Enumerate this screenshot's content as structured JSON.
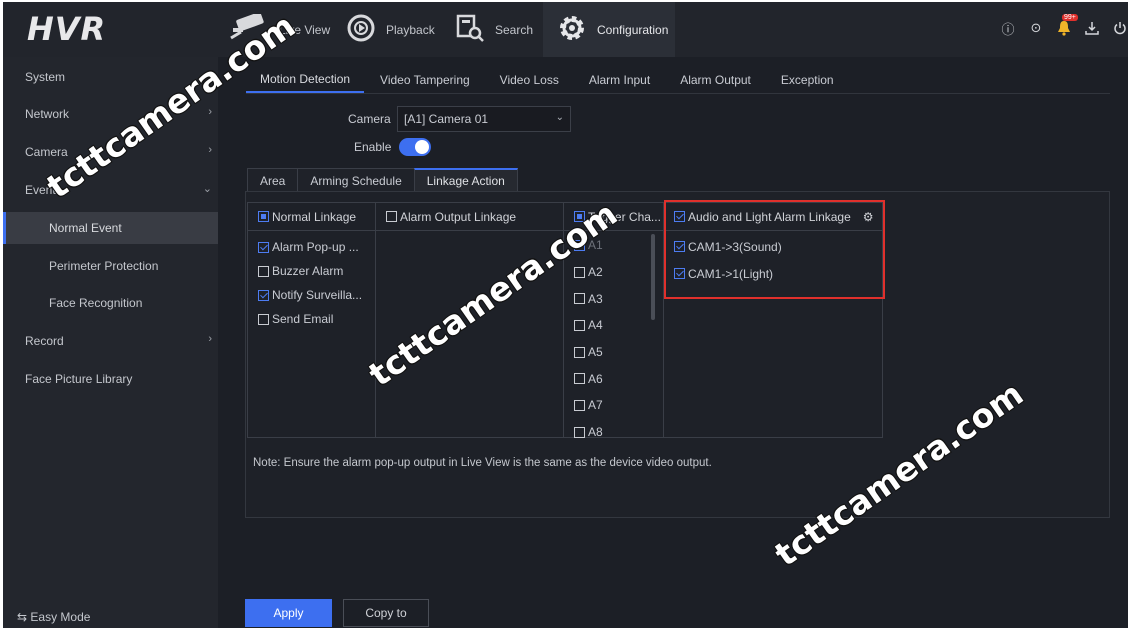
{
  "header": {
    "logo": "HVR",
    "nav": [
      {
        "label": "Live View",
        "icon": "camera-icon"
      },
      {
        "label": "Playback",
        "icon": "playback-icon"
      },
      {
        "label": "Search",
        "icon": "search-icon"
      },
      {
        "label": "Configuration",
        "icon": "gear-icon",
        "active": true
      }
    ],
    "badge": "99+"
  },
  "sidebar": {
    "items": [
      {
        "label": "System"
      },
      {
        "label": "Network"
      },
      {
        "label": "Camera"
      },
      {
        "label": "Event"
      },
      {
        "label": "Normal Event"
      },
      {
        "label": "Perimeter Protection"
      },
      {
        "label": "Face Recognition"
      },
      {
        "label": "Record"
      },
      {
        "label": "Face Picture Library"
      }
    ],
    "easy_mode": "⇆ Easy Mode"
  },
  "main_tabs": [
    "Motion Detection",
    "Video Tampering",
    "Video Loss",
    "Alarm Input",
    "Alarm Output",
    "Exception"
  ],
  "camera": {
    "label": "Camera",
    "value": "[A1] Camera 01"
  },
  "enable": {
    "label": "Enable",
    "on": true
  },
  "sub_tabs": [
    "Area",
    "Arming Schedule",
    "Linkage Action"
  ],
  "linkage": {
    "normal": {
      "header": "Normal Linkage",
      "items": [
        "Alarm Pop-up ...",
        "Buzzer Alarm",
        "Notify Surveilla...",
        "Send Email"
      ]
    },
    "alarm_output": {
      "header": "Alarm Output Linkage"
    },
    "trigger": {
      "header": "Trigger Cha...",
      "items": [
        "A1",
        "A2",
        "A3",
        "A4",
        "A5",
        "A6",
        "A7",
        "A8"
      ]
    },
    "audio_light": {
      "header": "Audio and Light Alarm Linkage",
      "items": [
        "CAM1->3(Sound)",
        "CAM1->1(Light)"
      ]
    }
  },
  "note": "Note: Ensure the alarm pop-up output in Live View is the same as the device video output.",
  "buttons": {
    "apply": "Apply",
    "copy_to": "Copy to"
  },
  "watermark": "tcttcamera.com",
  "colors": {
    "accent": "#3d6ff0",
    "highlight_box": "#e0302c",
    "background": "#1c1f26"
  }
}
